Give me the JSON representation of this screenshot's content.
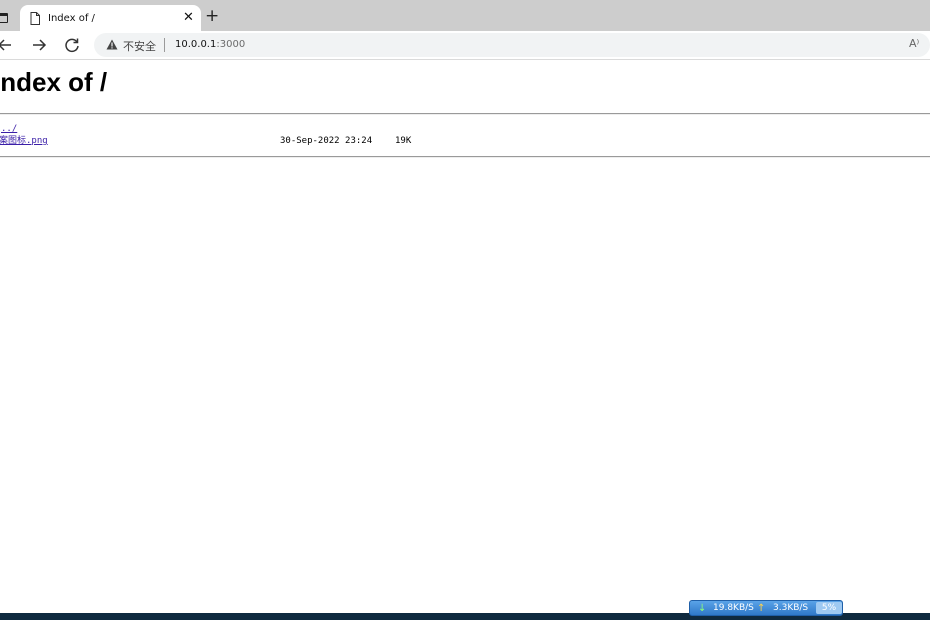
{
  "browser": {
    "tab": {
      "title": "Index of /"
    },
    "address_bar": {
      "security_label": "不安全",
      "url_host": "10.0.0.1",
      "url_port": ":3000"
    },
    "read_aloud_label": "A⁾"
  },
  "page": {
    "heading": "Index of /",
    "entries": [
      {
        "name": "../",
        "date": "",
        "size": ""
      },
      {
        "name": "文案图标.png",
        "date": "30-Sep-2022 23:24",
        "size": "19K"
      }
    ]
  },
  "net_meter": {
    "download": "19.8KB/S",
    "upload": "3.3KB/S",
    "cpu": "5%"
  }
}
